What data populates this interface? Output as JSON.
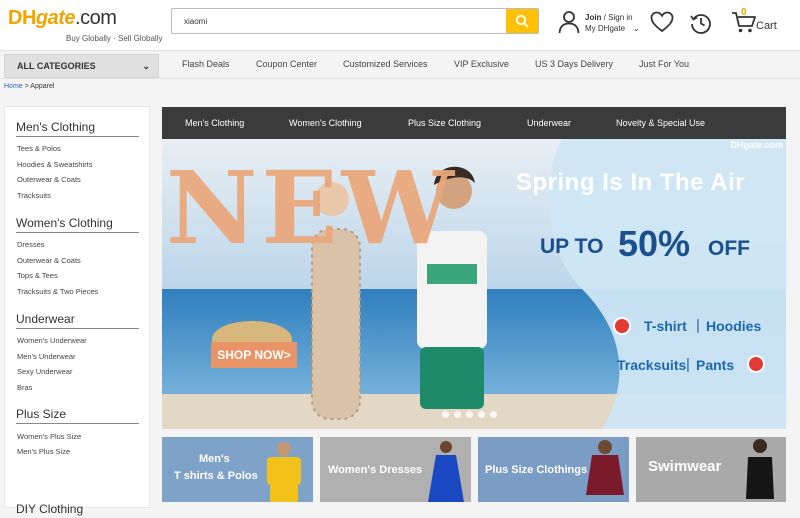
{
  "logo": {
    "dh": "DH",
    "gate": "gate",
    "com": ".com",
    "tagline": "Buy Globally · Sell Globally"
  },
  "search": {
    "value": "xiaomi",
    "icon": "search-icon"
  },
  "account": {
    "join": "Join",
    "sep": " / ",
    "sign_in": "Sign in",
    "my": "My DHgate",
    "icon": "user-icon"
  },
  "cart": {
    "count": "0",
    "label": "Cart"
  },
  "nav": {
    "all_categories": "ALL CATEGORIES",
    "items": [
      "Flash Deals",
      "Coupon Center",
      "Customized Services",
      "VIP Exclusive",
      "US 3 Days Delivery",
      "Just For You"
    ]
  },
  "breadcrumb": {
    "home": "Home",
    "sep": ">",
    "current": "Apparel"
  },
  "sidebar": {
    "sections": [
      {
        "title": "Men's Clothing",
        "items": [
          "Tees & Polos",
          "Hoodies & Sweatshirts",
          "Outerwear & Coats",
          "Tracksuits"
        ]
      },
      {
        "title": "Women's Clothing",
        "items": [
          "Dresses",
          "Outerwear & Coats",
          "Tops & Tees",
          "Tracksuits & Two Pieces"
        ]
      },
      {
        "title": "Underwear",
        "items": [
          "Women's Underwear",
          "Men's Underwear",
          "Sexy Underwear",
          "Bras"
        ]
      },
      {
        "title": "Plus Size",
        "items": [
          "Women's Plus Size",
          "Men's Plus Size"
        ]
      },
      {
        "title": "DIY Clothing",
        "items": []
      }
    ]
  },
  "category_bar": [
    "Men's Clothing",
    "Women's Clothing",
    "Plus Size Clothing",
    "Underwear",
    "Novelty & Special Use"
  ],
  "banner": {
    "big_word": "NEW",
    "watermark": "DHgate.com",
    "headline": "Spring Is In The Air",
    "up_to": "UP TO",
    "percent": "50%",
    "off": "OFF",
    "links": [
      "T-shirt",
      "Hoodies",
      "Tracksuits",
      "Pants"
    ],
    "divider": "|",
    "shop_now": "SHOP NOW>",
    "slide_count": 5,
    "colors": {
      "sky": "#c6dcee",
      "sea": "#3f8fc4",
      "accent": "#e99466",
      "text_blue": "#1b4f8f"
    }
  },
  "tiles": [
    {
      "line1": "Men's",
      "line2": "T shirts & Polos",
      "bg": "#7fa3c8"
    },
    {
      "line1": "Women's Dresses",
      "line2": "",
      "bg": "#b0b0b0"
    },
    {
      "line1": "Plus Size Clothings",
      "line2": "",
      "bg": "#7b9cc4"
    },
    {
      "line1": "Swimwear",
      "line2": "",
      "bg": "#a9a9a9"
    }
  ]
}
